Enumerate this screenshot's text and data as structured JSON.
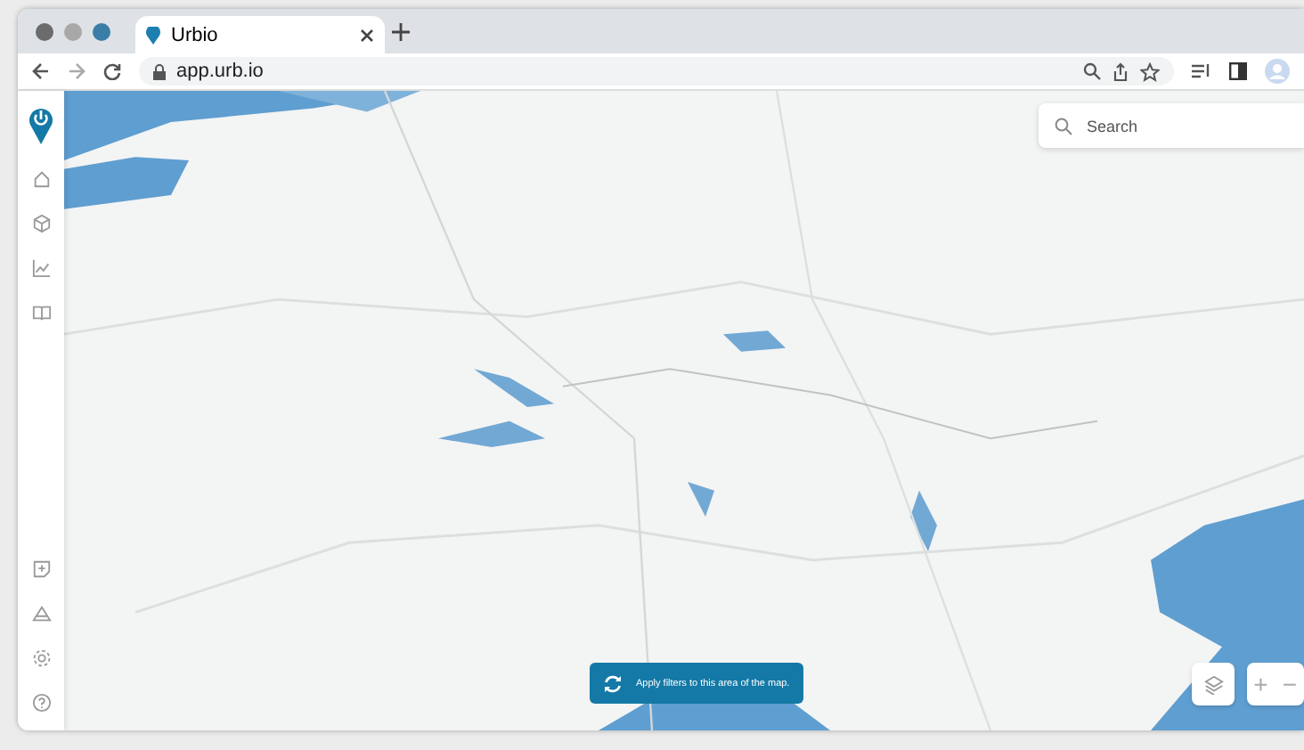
{
  "browser": {
    "tabs": [
      {
        "title": "Urbio",
        "selected": true
      }
    ],
    "url": "app.urb.io"
  },
  "search": {
    "placeholder": "Search"
  },
  "apply_button": {
    "label": "Apply filters to this area of the map."
  },
  "zoom_controls": {
    "zoom_in": "+",
    "zoom_out": "−"
  }
}
